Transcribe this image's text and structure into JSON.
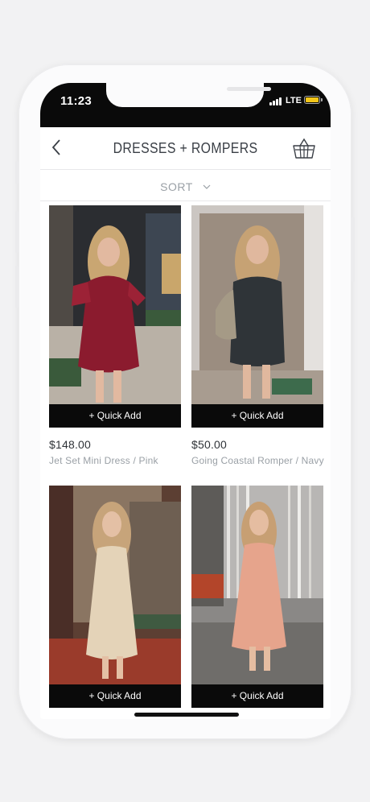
{
  "status": {
    "time": "11:23",
    "network": "LTE"
  },
  "header": {
    "title": "DRESSES + ROMPERS",
    "back_icon": "chevron-left-icon",
    "cart_icon": "basket-icon"
  },
  "sort": {
    "label": "SORT"
  },
  "products": [
    {
      "price": "$148.00",
      "name": "Jet Set Mini Dress / Pink",
      "quick_add": "+ Quick Add"
    },
    {
      "price": "$50.00",
      "name": "Going Coastal Romper / Navy",
      "quick_add": "+ Quick Add"
    },
    {
      "quick_add": "+ Quick Add"
    },
    {
      "quick_add": "+ Quick Add"
    }
  ],
  "colors": {
    "accent": "#0a0a0a",
    "text": "#3a3f46",
    "muted": "#9aa0a6"
  }
}
